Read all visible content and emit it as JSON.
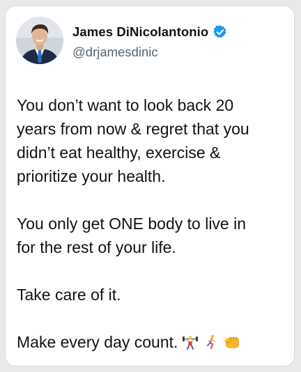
{
  "tweet": {
    "author": {
      "name": "James DiNicolantonio",
      "handle": "@drjamesdinic",
      "verified": true,
      "avatar_icon": "profile-photo-man-in-suit"
    },
    "paragraphs": [
      {
        "lines": [
          "You don’t want to look back 20",
          "years from now & regret that you",
          "didn’t eat healthy, exercise &",
          "prioritize your health."
        ]
      },
      {
        "lines": [
          "You only get ONE body to live in",
          "for the rest of your life."
        ]
      },
      {
        "lines": [
          "Take care of it."
        ]
      },
      {
        "lines": [
          "Make every day count."
        ],
        "emojis": [
          "weightlifter-emoji",
          "runner-emoji",
          "fist-bump-emoji"
        ]
      }
    ]
  },
  "colors": {
    "text": "#0f1419",
    "secondary_text": "#536471",
    "verified_badge": "#1d9bf0",
    "card_background": "#ffffff"
  }
}
